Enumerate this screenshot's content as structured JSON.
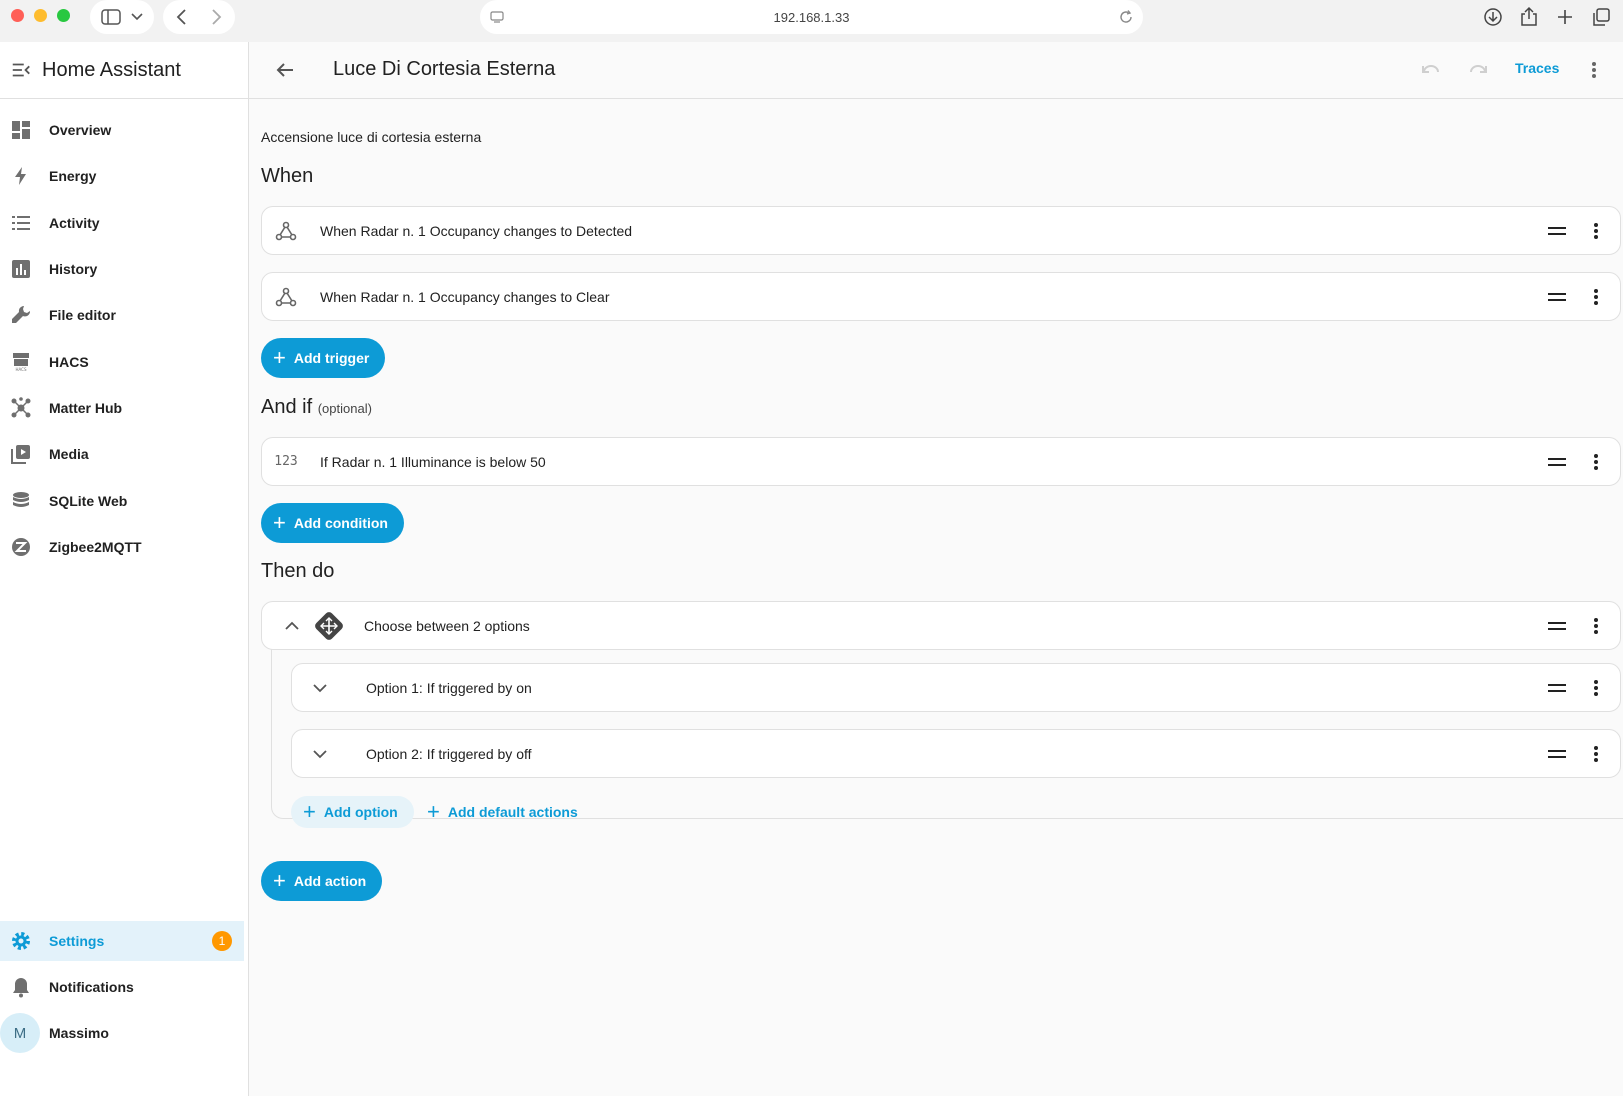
{
  "browser": {
    "url": "192.168.1.33",
    "colors": {
      "close": "#ff5f57",
      "minimize": "#febc2e",
      "zoom": "#28c840"
    }
  },
  "sidebar": {
    "title": "Home Assistant",
    "items": [
      {
        "label": "Overview",
        "icon": "dashboard-icon"
      },
      {
        "label": "Energy",
        "icon": "lightning-icon"
      },
      {
        "label": "Activity",
        "icon": "list-icon"
      },
      {
        "label": "History",
        "icon": "chart-icon"
      },
      {
        "label": "File editor",
        "icon": "wrench-icon"
      },
      {
        "label": "HACS",
        "icon": "hacs-icon"
      },
      {
        "label": "Matter Hub",
        "icon": "hub-icon"
      },
      {
        "label": "Media",
        "icon": "media-icon"
      },
      {
        "label": "SQLite Web",
        "icon": "database-icon"
      },
      {
        "label": "Zigbee2MQTT",
        "icon": "zigbee-icon"
      }
    ],
    "settings": {
      "label": "Settings",
      "badge": "1"
    },
    "notifications": {
      "label": "Notifications"
    },
    "user": {
      "initial": "M",
      "name": "Massimo"
    }
  },
  "topbar": {
    "title": "Luce Di Cortesia Esterna",
    "traces_label": "Traces"
  },
  "main": {
    "description": "Accensione luce di cortesia esterna",
    "when": {
      "heading": "When",
      "triggers": [
        {
          "text": "When Radar n. 1 Occupancy changes to Detected"
        },
        {
          "text": "When Radar n. 1 Occupancy changes to Clear"
        }
      ],
      "add_label": "Add trigger"
    },
    "and_if": {
      "heading": "And if",
      "optional": "(optional)",
      "conditions": [
        {
          "icon_text": "123",
          "text": "If Radar n. 1 Illuminance is below 50"
        }
      ],
      "add_label": "Add condition"
    },
    "then_do": {
      "heading": "Then do",
      "choose": {
        "text": "Choose between 2 options",
        "options": [
          {
            "text": "Option 1: If triggered by on"
          },
          {
            "text": "Option 2: If triggered by off"
          }
        ],
        "add_option_label": "Add option",
        "add_default_label": "Add default actions"
      },
      "add_label": "Add action"
    }
  },
  "colors": {
    "accent": "#0d9bd6",
    "badge": "#ff9800"
  }
}
